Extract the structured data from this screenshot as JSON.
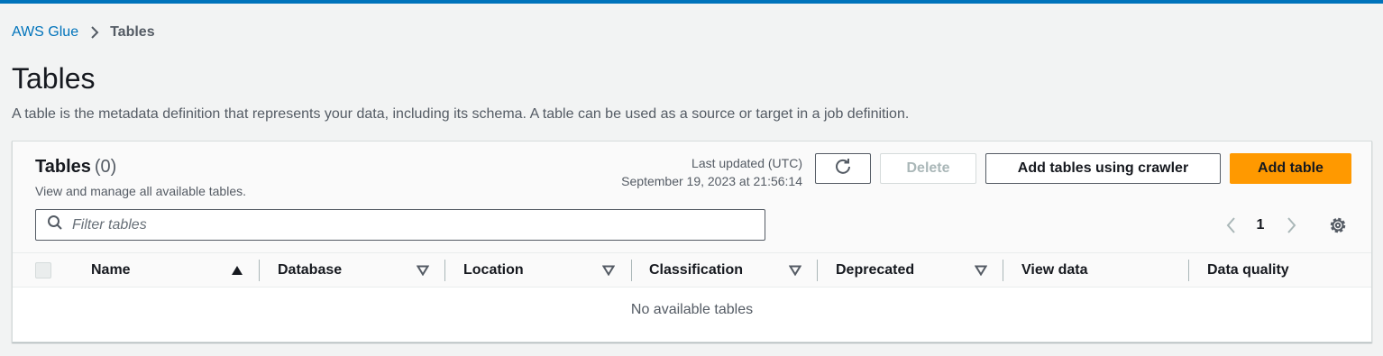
{
  "breadcrumb": {
    "root": "AWS Glue",
    "current": "Tables"
  },
  "page": {
    "title": "Tables",
    "description": "A table is the metadata definition that represents your data, including its schema. A table can be used as a source or target in a job definition."
  },
  "panel": {
    "title": "Tables",
    "count": "(0)",
    "description": "View and manage all available tables.",
    "last_updated_label": "Last updated (UTC)",
    "last_updated_value": "September 19, 2023 at 21:56:14",
    "buttons": {
      "delete": "Delete",
      "add_crawler": "Add tables using crawler",
      "add_table": "Add table"
    },
    "filter_placeholder": "Filter tables",
    "pagination": {
      "current_page": "1"
    },
    "columns": [
      "Name",
      "Database",
      "Location",
      "Classification",
      "Deprecated",
      "View data",
      "Data quality"
    ],
    "empty_message": "No available tables"
  },
  "colors": {
    "accent": "#0073bb",
    "primary_button": "#ff9900",
    "background": "#f2f3f3"
  },
  "icons": {
    "breadcrumb_separator": "chevron-right-icon",
    "refresh": "refresh-icon",
    "search": "search-icon",
    "sort_ascending": "sort-ascending-icon",
    "sort_descending": "sort-descending-icon",
    "pager_previous": "chevron-left-icon",
    "pager_next": "chevron-right-icon",
    "settings": "gear-icon"
  }
}
